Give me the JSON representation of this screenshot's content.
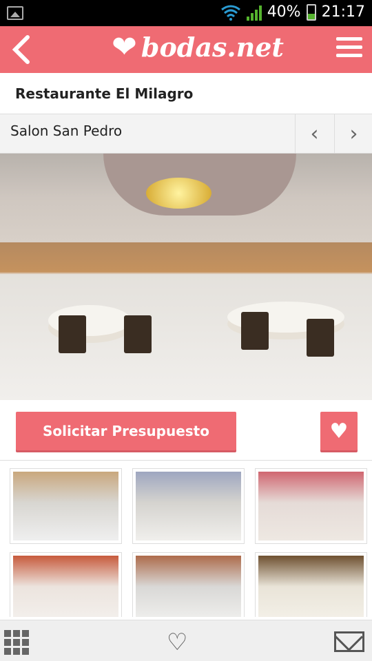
{
  "status": {
    "battery": "40%",
    "time": "21:17"
  },
  "header": {
    "brand": "bodas.net"
  },
  "venue": {
    "title": "Restaurante El Milagro"
  },
  "hall": {
    "name": "Salon San Pedro",
    "prev_icon": "chevron-left-icon",
    "next_icon": "chevron-right-icon"
  },
  "cta": {
    "request_label": "Solicitar Presupuesto"
  },
  "gallery": {
    "thumbs": [
      "photo",
      "photo",
      "photo",
      "photo",
      "photo",
      "photo"
    ]
  },
  "colors": {
    "brand": "#ef6b73",
    "background": "#ffffff"
  }
}
